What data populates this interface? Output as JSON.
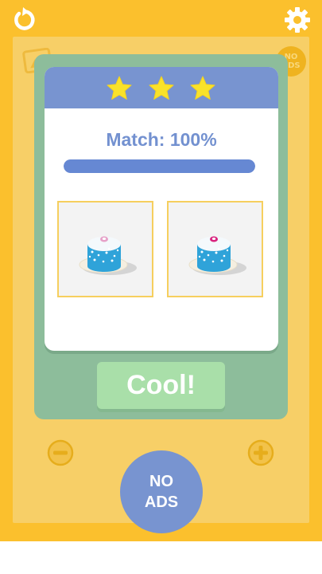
{
  "result": {
    "stars_earned": 3,
    "stars_total": 3,
    "match_text": "Match: 100%",
    "match_fraction": 1.0
  },
  "buttons": {
    "cool_label": "Cool!",
    "no_ads_label_line1": "NO",
    "no_ads_label_line2": "ADS"
  },
  "background": {
    "no_ads_small_line1": "NO",
    "no_ads_small_line2": "ADS"
  },
  "icons": {
    "restart": "restart-icon",
    "settings": "gear-icon",
    "zoom_out": "minus-icon",
    "zoom_in": "plus-icon",
    "star": "star-icon"
  },
  "colors": {
    "background": "#fbc02d",
    "overlay": "#8dbd9b",
    "header": "#7894d0",
    "star": "#f9e22a",
    "match_text": "#7391d0",
    "progress": "#6688d3",
    "button": "#a9dfa9"
  }
}
